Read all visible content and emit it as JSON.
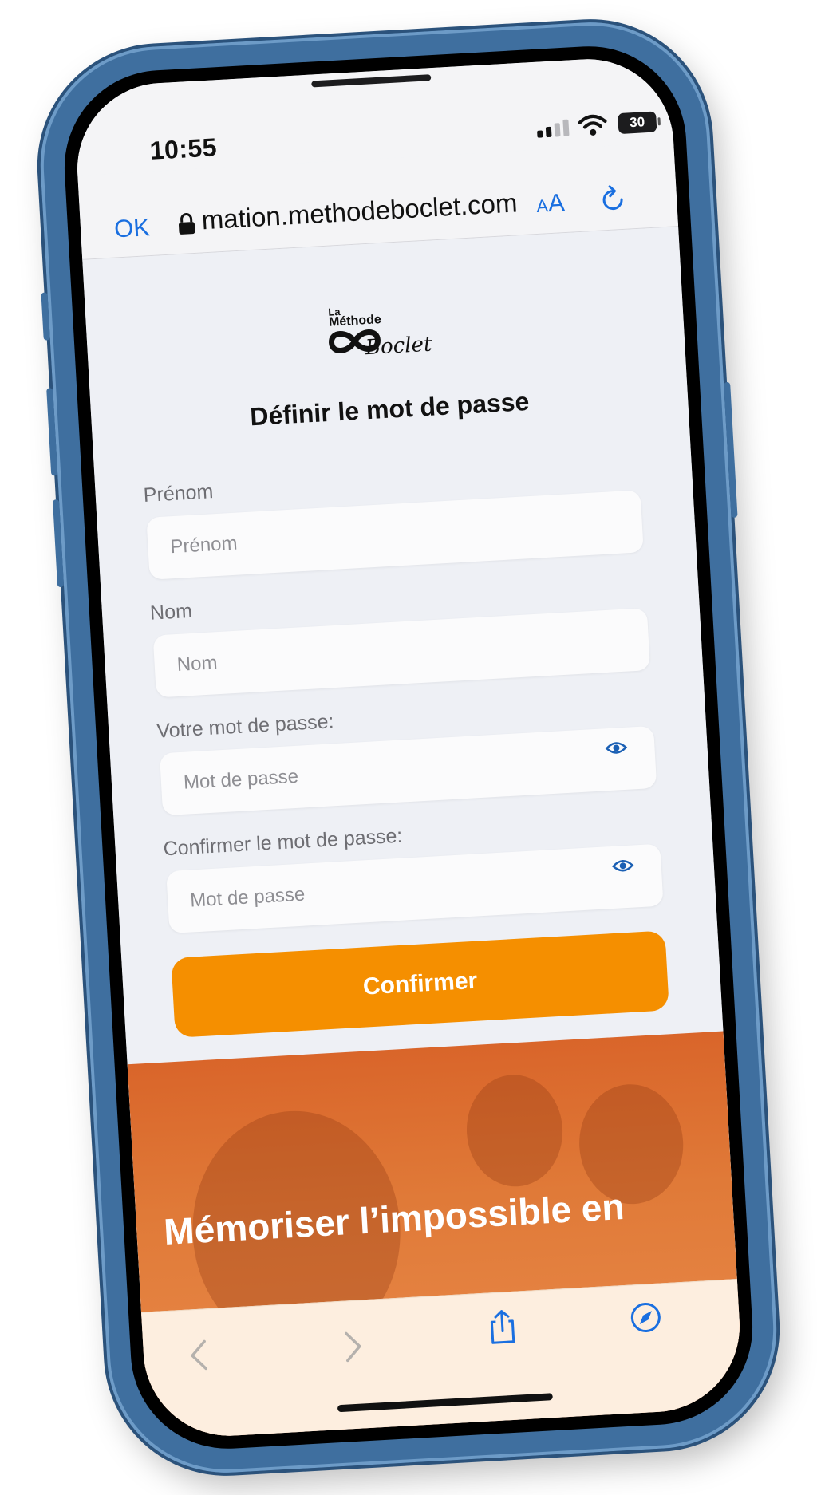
{
  "status_bar": {
    "time": "10:55",
    "battery": "30"
  },
  "browser": {
    "done_label": "OK",
    "url": "mation.methodeboclet.com",
    "text_size_small": "A",
    "text_size_large": "A"
  },
  "logo": {
    "line1": "La",
    "line2": "Méthode",
    "line3": "Boclet"
  },
  "form": {
    "title": "Définir le mot de passe",
    "first_name": {
      "label": "Prénom",
      "placeholder": "Prénom"
    },
    "last_name": {
      "label": "Nom",
      "placeholder": "Nom"
    },
    "password": {
      "label": "Votre mot de passe:",
      "placeholder": "Mot de passe"
    },
    "confirm_password": {
      "label": "Confirmer le mot de passe:",
      "placeholder": "Mot de passe"
    },
    "submit_label": "Confirmer"
  },
  "banner": {
    "headline": "Mémoriser l’impossible en"
  },
  "colors": {
    "accent": "#f58f00",
    "link": "#1a6fe0",
    "banner": "#e07a38",
    "phone_frame": "#3f6f9f"
  },
  "icons": {
    "lock": "lock-icon",
    "reload": "reload-icon",
    "eye": "eye-icon",
    "back": "chevron-left-icon",
    "forward": "chevron-right-icon",
    "share": "share-icon",
    "compass": "compass-icon"
  }
}
